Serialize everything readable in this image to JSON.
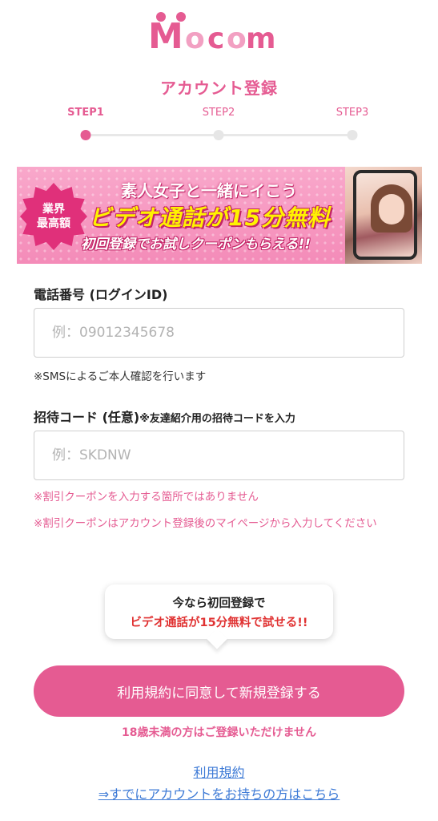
{
  "brand": {
    "logo_text": "Mocom",
    "accent": "#e55b92"
  },
  "page": {
    "title": "アカウント登録"
  },
  "steps": [
    {
      "label": "STEP1",
      "active": true
    },
    {
      "label": "STEP2",
      "active": false
    },
    {
      "label": "STEP3",
      "active": false
    }
  ],
  "banner": {
    "badge_line1": "業界",
    "badge_line2": "最高額",
    "line1": "素人女子と一緒にイこう",
    "line2": "ビデオ通話が15分無料",
    "line3": "初回登録でお試しクーポンもらえる!!"
  },
  "phone_field": {
    "label": "電話番号 (ログインID)",
    "placeholder": "例：09012345678",
    "note": "※SMSによるご本人確認を行います"
  },
  "invite_field": {
    "label": "招待コード (任意)",
    "label_sub": "※友達紹介用の招待コードを入力",
    "placeholder": "例：SKDNW",
    "note1": "※割引クーポンを入力する箇所ではありません",
    "note2": "※割引クーポンはアカウント登録後のマイページから入力してください"
  },
  "promo_bubble": {
    "line1": "今なら初回登録で",
    "line2": "ビデオ通話が15分無料で試せる!!"
  },
  "cta": {
    "label": "利用規約に同意して新規登録する"
  },
  "age_note": "18歳未満の方はご登録いただけません",
  "links": {
    "terms": "利用規約",
    "existing_account": "⇒すでにアカウントをお持ちの方はこちら"
  }
}
